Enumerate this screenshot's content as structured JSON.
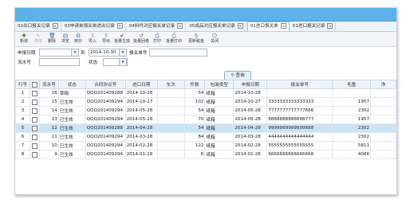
{
  "tabs": [
    {
      "label": "02出口报关记录",
      "active": false
    },
    {
      "label": "03申请单报关单进出记录",
      "active": false
    },
    {
      "label": "04料件对应报关单记录",
      "active": false
    },
    {
      "label": "05成品对应报关单记录",
      "active": false
    },
    {
      "label": "01进口报关单",
      "active": true
    },
    {
      "label": "01进口报关记录",
      "active": false
    }
  ],
  "toolbar": [
    {
      "label": "新增",
      "icon": "plus-icon",
      "disabled": false
    },
    {
      "label": "修改",
      "icon": "edit-icon",
      "disabled": true
    },
    {
      "label": "删除",
      "icon": "trash-icon",
      "disabled": false
    },
    {
      "label": "浏览",
      "icon": "browse-icon",
      "disabled": false
    },
    {
      "label": "转抄",
      "icon": "copy-icon",
      "disabled": false
    },
    {
      "label": "导入",
      "icon": "import-icon",
      "disabled": false
    },
    {
      "label": "导出",
      "icon": "export-icon",
      "disabled": false
    },
    {
      "label": "批量生效",
      "icon": "check-icon",
      "disabled": false
    },
    {
      "label": "批量回卷",
      "icon": "rollback-icon",
      "disabled": false
    },
    {
      "label": "打印",
      "icon": "print-icon",
      "disabled": false
    },
    {
      "label": "批量打印",
      "icon": "batch-print-icon",
      "disabled": false
    },
    {
      "label": "更新税金",
      "icon": "tax-icon",
      "disabled": false
    },
    {
      "label": "关闭",
      "icon": "power-icon",
      "disabled": false
    }
  ],
  "filters": {
    "declare_date_label": "申报日期",
    "to_label": "到",
    "date_to": "2014-10-30",
    "customs_no_label": "报关单号",
    "serial_label": "流水号",
    "status_label": "状态",
    "query_button": "查询"
  },
  "table": {
    "headers": [
      "行号",
      "",
      "流水号",
      "状态",
      "合同协议号",
      "进口日期",
      "车次",
      "件数",
      "包装类型",
      "申报日期",
      "报关单号",
      "毛重",
      "净"
    ],
    "rows": [
      [
        "1",
        "",
        "16",
        "草稿",
        "QQQ201409288",
        "2014-10-28",
        "",
        "54",
        "纸箱",
        "2014-10-28",
        "",
        ""
      ],
      [
        "2",
        "",
        "15",
        "已生效",
        "QQQ201409294",
        "2014-10-27",
        "",
        "102",
        "纸箱",
        "2014-10-27",
        "3333333333333333",
        "1957"
      ],
      [
        "3",
        "",
        "14",
        "已生效",
        "QQQ201409294",
        "2014-05-28",
        "",
        "54",
        "纸箱",
        "2014-05-28",
        "7777777777777666",
        "2302"
      ],
      [
        "4",
        "",
        "13",
        "已生效",
        "QQQ201409294",
        "2014-05-28",
        "",
        "70",
        "纸箱",
        "2014-05-28",
        "8888888888888777",
        "1957"
      ],
      [
        "5",
        "",
        "12",
        "已生效",
        "QQQ201409288",
        "2014-04-28",
        "",
        "54",
        "纸箱",
        "2014-04-28",
        "9999999999999888",
        "2302"
      ],
      [
        "6",
        "",
        "11",
        "已生效",
        "QQQ201409294",
        "2014-03-28",
        "",
        "84",
        "纸箱",
        "2014-03-28",
        "4444444444444444",
        "2302"
      ],
      [
        "7",
        "",
        "10",
        "已生效",
        "QQQ201409294",
        "2014-02-28",
        "",
        "122",
        "纸箱",
        "2014-02-28",
        "5555555555555555",
        "5811"
      ],
      [
        "8",
        "",
        "9",
        "已生效",
        "QQQ201409294",
        "2014-01-28",
        "",
        "6",
        "纸箱",
        "2014-01-28",
        "6666666666666666",
        "4086"
      ]
    ],
    "selected_row": 4
  }
}
